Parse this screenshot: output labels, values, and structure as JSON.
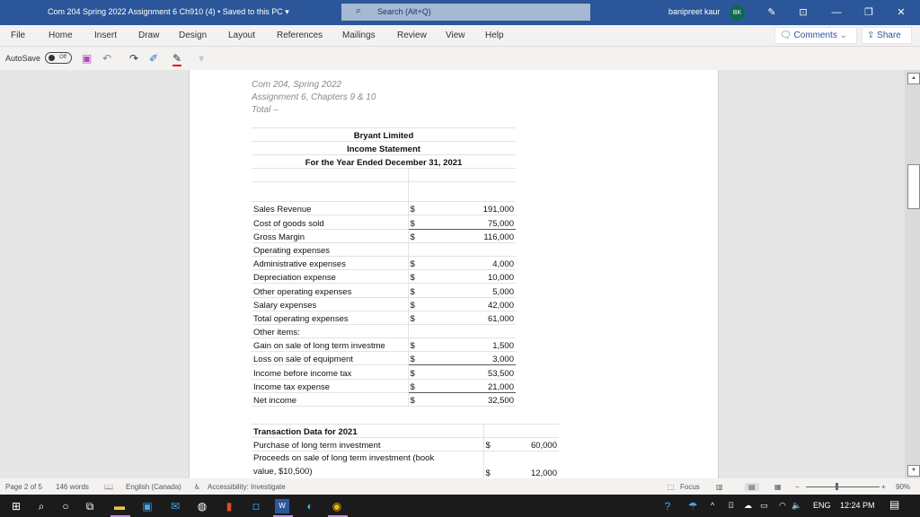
{
  "window": {
    "title": "Com 204 Spring 2022 Assignment 6 Ch910 (4) • Saved to this PC ▾",
    "search_placeholder": "Search (Alt+Q)",
    "user_name": "banipreet kaur",
    "user_initials": "BK",
    "colors": {
      "titlebar": "#2b579a",
      "avatar": "#0b6a52"
    }
  },
  "ribbon": {
    "tabs": [
      "File",
      "Home",
      "Insert",
      "Draw",
      "Design",
      "Layout",
      "References",
      "Mailings",
      "Review",
      "View",
      "Help"
    ],
    "comments_label": "Comments",
    "share_label": "Share"
  },
  "qat": {
    "autosave_label": "AutoSave",
    "autosave_state": "Off"
  },
  "document": {
    "header_lines": [
      "Com 204, Spring 2022",
      "Assignment 6, Chapters 9 & 10",
      "Total –"
    ],
    "income_statement": {
      "company": "Bryant Limited",
      "statement": "Income Statement",
      "period": "For the Year Ended December 31, 2021",
      "rows": [
        {
          "label": "Sales Revenue",
          "dollar": "$",
          "amount": "191,000"
        },
        {
          "label": "Cost of goods sold",
          "dollar": "$",
          "amount": "75,000",
          "underline": true
        },
        {
          "label": "Gross Margin",
          "dollar": "$",
          "amount": "116,000"
        },
        {
          "label": "Operating expenses",
          "dollar": "",
          "amount": ""
        },
        {
          "label": "Administrative expenses",
          "dollar": "$",
          "amount": "4,000"
        },
        {
          "label": "Depreciation expense",
          "dollar": "$",
          "amount": "10,000"
        },
        {
          "label": "Other operating expenses",
          "dollar": "$",
          "amount": "5,000"
        },
        {
          "label": "Salary expenses",
          "dollar": "$",
          "amount": "42,000"
        },
        {
          "label": "Total operating expenses",
          "dollar": "$",
          "amount": "61,000"
        },
        {
          "label": "Other items:",
          "dollar": "",
          "amount": ""
        },
        {
          "label": "Gain on sale of long term investme",
          "dollar": "$",
          "amount": "1,500"
        },
        {
          "label": "Loss on sale of equipment",
          "dollar": "$",
          "amount": "3,000",
          "underline": true
        },
        {
          "label": "Income before income tax",
          "dollar": "$",
          "amount": "53,500"
        },
        {
          "label": "Income tax expense",
          "dollar": "$",
          "amount": "21,000",
          "underline": true
        },
        {
          "label": "Net income",
          "dollar": "$",
          "amount": "32,500"
        }
      ]
    },
    "transactions": {
      "title": "Transaction Data for 2021",
      "rows": [
        {
          "label": "Purchase of long term investment",
          "dollar": "$",
          "amount": "60,000"
        },
        {
          "label": "Proceeds on sale of long term investment (book",
          "label2": "value, $10,500)",
          "dollar": "$",
          "amount": "12,000"
        }
      ]
    }
  },
  "status_bar": {
    "page": "Page 2 of 5",
    "words": "146 words",
    "language": "English (Canada)",
    "accessibility": "Accessibility: Investigate",
    "focus_label": "Focus",
    "zoom_minus": "−",
    "zoom_plus": "+",
    "zoom_level": "90%",
    "zoom_fraction": 0.42
  },
  "taskbar": {
    "language": "ENG",
    "time": "12:24 PM"
  }
}
